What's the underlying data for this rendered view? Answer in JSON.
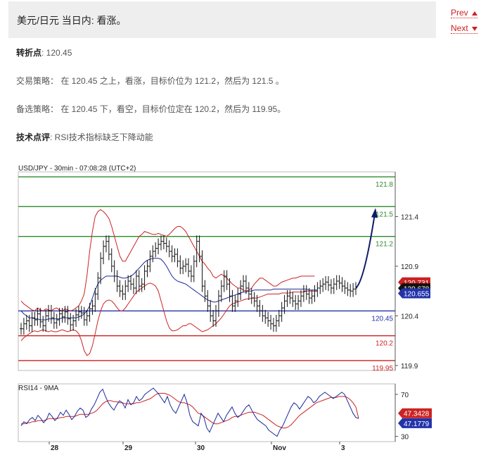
{
  "header": {
    "title": "美元/日元 当日内: 看涨。"
  },
  "nav": {
    "prev_label": "Prev",
    "next_label": "Next"
  },
  "pivot": {
    "label": "转折点",
    "value": ": 120.45"
  },
  "strategy": {
    "label": "交易策略：",
    "text": " 在 120.45 之上，看涨，目标价位为 121.2，然后为 121.5 。"
  },
  "alternative": {
    "label": "备选策略：",
    "text": " 在 120.45 下，看空，目标价位定在 120.2，然后为 119.95。"
  },
  "comment": {
    "label": "技术点评",
    "text": ": RSI技术指标缺乏下降动能"
  },
  "chart_data": {
    "type": "line",
    "title": "USD/JPY - 30min - 07:08:28 (UTC+2)",
    "price_axis": {
      "ylim": [
        119.85,
        121.85
      ],
      "ticks": [
        "121.4",
        "120.9",
        "120.4",
        "119.9"
      ]
    },
    "levels": [
      {
        "value": 121.8,
        "label": "121.8",
        "color": "#2e8b2e"
      },
      {
        "value": 121.5,
        "label": "121.5",
        "color": "#2e8b2e"
      },
      {
        "value": 121.2,
        "label": "121.2",
        "color": "#2e8b2e"
      },
      {
        "value": 120.45,
        "label": "120.45",
        "color": "#2233aa"
      },
      {
        "value": 120.2,
        "label": "120.2",
        "color": "#cc2222"
      },
      {
        "value": 119.95,
        "label": "119.95",
        "color": "#cc2222"
      }
    ],
    "price_tags": [
      {
        "value": 120.731,
        "label": "120.731",
        "color": "#cc2222"
      },
      {
        "value": 120.678,
        "label": "120.678",
        "color": "#111111"
      },
      {
        "value": 120.655,
        "label": "120.655",
        "color": "#2233aa"
      }
    ],
    "x_ticks": [
      "28",
      "29",
      "30",
      "Nov",
      "3"
    ],
    "close": [
      120.27,
      120.32,
      120.35,
      120.3,
      120.38,
      120.36,
      120.42,
      120.34,
      120.3,
      120.4,
      120.45,
      120.38,
      120.33,
      120.36,
      120.42,
      120.39,
      120.44,
      120.37,
      120.31,
      120.35,
      120.41,
      120.44,
      120.43,
      120.36,
      120.4,
      120.47,
      120.5,
      120.62,
      120.78,
      120.98,
      121.1,
      121.15,
      121.02,
      120.9,
      120.8,
      120.7,
      120.65,
      120.62,
      120.7,
      120.75,
      120.72,
      120.68,
      120.8,
      120.7,
      120.72,
      120.85,
      120.9,
      121.0,
      121.05,
      121.08,
      121.12,
      121.15,
      121.13,
      121.1,
      121.05,
      121.0,
      121.02,
      120.95,
      120.88,
      120.9,
      120.92,
      120.85,
      120.8,
      120.95,
      121.15,
      121.0,
      120.7,
      120.6,
      120.5,
      120.4,
      120.35,
      120.45,
      120.6,
      120.7,
      120.8,
      120.72,
      120.6,
      120.5,
      120.55,
      120.62,
      120.7,
      120.75,
      120.68,
      120.62,
      120.58,
      120.55,
      120.5,
      120.45,
      120.4,
      120.38,
      120.35,
      120.32,
      120.3,
      120.35,
      120.4,
      120.48,
      120.55,
      120.6,
      120.58,
      120.55,
      120.52,
      120.55,
      120.6,
      120.65,
      120.62,
      120.58,
      120.6,
      120.65,
      120.68,
      120.7,
      120.72,
      120.74,
      120.71,
      120.68,
      120.72,
      120.75,
      120.73,
      120.7,
      120.68,
      120.66,
      120.65,
      120.67,
      120.68
    ],
    "projection_target": 121.5,
    "upper_band": [
      120.55,
      120.52,
      120.5,
      120.48,
      120.46,
      120.45,
      120.48,
      120.46,
      120.45,
      120.47,
      120.46,
      120.45,
      120.47,
      120.48,
      120.46,
      120.45,
      120.47,
      120.46,
      120.45,
      120.46,
      120.48,
      120.5,
      120.55,
      120.62,
      120.8,
      121.05,
      121.25,
      121.4,
      121.45,
      121.47,
      121.45,
      121.42,
      121.38,
      121.3,
      121.2,
      121.1,
      121.0,
      120.95,
      120.95,
      121.0,
      121.05,
      121.1,
      121.15,
      121.2,
      121.22,
      121.25,
      121.24,
      121.23,
      121.22,
      121.22,
      121.23,
      121.22,
      121.21,
      121.2,
      121.22,
      121.25,
      121.28,
      121.3,
      121.3,
      121.28,
      121.25,
      121.2,
      121.15,
      121.1,
      121.05,
      121.0,
      120.95,
      120.92,
      120.88,
      120.85,
      120.8,
      120.78,
      120.8,
      120.82,
      120.8,
      120.78,
      120.75,
      120.72,
      120.7,
      120.68,
      120.68,
      120.66,
      120.65,
      120.66,
      120.68,
      120.72,
      120.75,
      120.78,
      120.78,
      120.76,
      120.74,
      120.72,
      120.7,
      120.7,
      120.72,
      120.74,
      120.75,
      120.76,
      120.77,
      120.78,
      120.78,
      120.79,
      120.8,
      120.8,
      120.8,
      120.8,
      120.8,
      120.8
    ],
    "lower_band": [
      120.15,
      120.18,
      120.2,
      120.22,
      120.24,
      120.25,
      120.24,
      120.25,
      120.26,
      120.25,
      120.24,
      120.25,
      120.24,
      120.24,
      120.25,
      120.26,
      120.25,
      120.24,
      120.25,
      120.26,
      120.25,
      120.22,
      120.15,
      120.05,
      120.0,
      120.02,
      120.1,
      120.22,
      120.35,
      120.45,
      120.52,
      120.55,
      120.56,
      120.55,
      120.52,
      120.48,
      120.45,
      120.45,
      120.48,
      120.52,
      120.56,
      120.6,
      120.64,
      120.66,
      120.68,
      120.7,
      120.72,
      120.73,
      120.72,
      120.7,
      120.65,
      120.55,
      120.45,
      120.35,
      120.28,
      120.25,
      120.25,
      120.26,
      120.28,
      120.3,
      120.3,
      120.32,
      120.32,
      120.3,
      120.28,
      120.26,
      120.24,
      120.25,
      120.26,
      120.28,
      120.3,
      120.32,
      120.35,
      120.38,
      120.42,
      120.46,
      120.5,
      120.52,
      120.53,
      120.54,
      120.55,
      120.56,
      120.57,
      120.57,
      120.58,
      120.58,
      120.58,
      120.59,
      120.6,
      120.61,
      120.62,
      120.62,
      120.62,
      120.62,
      120.62,
      120.63,
      120.63,
      120.63,
      120.63,
      120.64,
      120.64,
      120.64,
      120.64,
      120.64,
      120.65,
      120.65,
      120.65,
      120.65
    ],
    "ma": [
      120.45,
      120.42,
      120.4,
      120.38,
      120.38,
      120.37,
      120.37,
      120.36,
      120.36,
      120.36,
      120.37,
      120.37,
      120.37,
      120.37,
      120.37,
      120.38,
      120.38,
      120.38,
      120.38,
      120.38,
      120.38,
      120.39,
      120.4,
      120.42,
      120.45,
      120.5,
      120.58,
      120.66,
      120.72,
      120.76,
      120.78,
      120.8,
      120.8,
      120.8,
      120.8,
      120.8,
      120.79,
      120.78,
      120.78,
      120.79,
      120.8,
      120.82,
      120.85,
      120.88,
      120.91,
      120.94,
      120.96,
      120.97,
      120.98,
      120.98,
      120.98,
      120.97,
      120.94,
      120.9,
      120.85,
      120.8,
      120.77,
      120.75,
      120.74,
      120.73,
      120.72,
      120.7,
      120.68,
      120.66,
      120.64,
      120.62,
      120.6,
      120.58,
      120.56,
      120.55,
      120.54,
      120.54,
      120.55,
      120.56,
      120.57,
      120.58,
      120.59,
      120.6,
      120.61,
      120.62,
      120.63,
      120.64,
      120.64,
      120.65,
      120.65,
      120.66,
      120.66,
      120.66,
      120.66,
      120.66,
      120.66,
      120.66,
      120.67,
      120.67,
      120.67,
      120.67,
      120.67,
      120.67,
      120.67,
      120.67,
      120.67,
      120.67,
      120.67,
      120.67,
      120.67,
      120.66,
      120.66,
      120.66,
      120.66
    ],
    "rsi": {
      "title": "RSI14 - 9MA",
      "ylim": [
        25,
        80
      ],
      "ticks": [
        "70",
        "30"
      ],
      "rsi_tag": {
        "value": 47.3428,
        "label": "47.3428",
        "color": "#cc2222"
      },
      "ma_tag": {
        "value": 47.1779,
        "label": "47.1779",
        "color": "#2233aa"
      },
      "rsi_values": [
        40,
        44,
        42,
        46,
        48,
        45,
        50,
        47,
        43,
        46,
        52,
        49,
        45,
        48,
        53,
        50,
        55,
        51,
        46,
        49,
        54,
        57,
        55,
        48,
        50,
        56,
        60,
        66,
        72,
        75,
        68,
        62,
        58,
        55,
        60,
        64,
        62,
        57,
        65,
        60,
        62,
        68,
        64,
        66,
        70,
        72,
        74,
        76,
        73,
        70,
        66,
        62,
        68,
        60,
        55,
        52,
        58,
        64,
        70,
        62,
        50,
        44,
        42,
        40,
        52,
        48,
        38,
        34,
        40,
        46,
        52,
        48,
        44,
        50,
        54,
        58,
        52,
        48,
        50,
        54,
        58,
        60,
        55,
        50,
        46,
        44,
        42,
        40,
        36,
        34,
        32,
        30,
        36,
        40,
        46,
        52,
        58,
        62,
        60,
        56,
        60,
        64,
        68,
        66,
        62,
        64,
        68,
        70,
        72,
        70,
        68,
        66,
        68,
        70,
        72,
        70,
        64,
        58,
        52,
        48,
        47
      ],
      "ma_values": [
        42,
        42,
        43,
        43,
        44,
        44,
        45,
        45,
        45,
        46,
        47,
        47,
        47,
        47,
        48,
        48,
        49,
        49,
        49,
        49,
        50,
        51,
        51,
        51,
        51,
        52,
        53,
        55,
        58,
        61,
        63,
        64,
        64,
        63,
        63,
        62,
        62,
        61,
        61,
        61,
        61,
        62,
        62,
        63,
        64,
        65,
        66,
        68,
        70,
        71,
        71,
        71,
        70,
        69,
        67,
        65,
        63,
        62,
        62,
        61,
        60,
        58,
        55,
        52,
        51,
        49,
        47,
        45,
        43,
        42,
        42,
        43,
        44,
        45,
        46,
        48,
        49,
        49,
        50,
        51,
        52,
        53,
        53,
        53,
        52,
        51,
        50,
        48,
        46,
        44,
        42,
        40,
        39,
        38,
        38,
        39,
        41,
        44,
        47,
        50,
        52,
        54,
        56,
        58,
        60,
        62,
        63,
        64,
        65,
        66,
        67,
        67,
        67,
        68,
        68,
        68,
        67,
        65,
        62,
        58,
        47
      ]
    }
  }
}
